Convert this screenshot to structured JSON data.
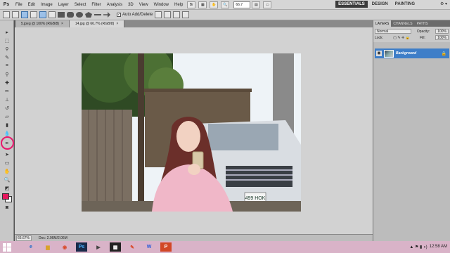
{
  "app": {
    "logo": "Ps"
  },
  "menu": [
    "File",
    "Edit",
    "Image",
    "Layer",
    "Select",
    "Filter",
    "Analysis",
    "3D",
    "View",
    "Window",
    "Help"
  ],
  "menubar": {
    "zoom": "66.7"
  },
  "workspaces": [
    "ESSENTIALS",
    "DESIGN",
    "PAINTING"
  ],
  "cs_live": "CS Live",
  "options": {
    "auto_add_delete": "Auto Add/Delete"
  },
  "tabs": [
    {
      "label": "5.jpeg @ 100% (RGB/8)",
      "close": "×"
    },
    {
      "label": "14.jpg @ 66.7% (RGB/8)",
      "close": "×"
    }
  ],
  "status": {
    "zoom": "66.67%",
    "doc": "Doc: 2.06M/2.06M"
  },
  "panels": {
    "tabs": [
      "LAYERS",
      "CHANNELS",
      "PATHS"
    ],
    "blend_mode": "Normal",
    "opacity_label": "Opacity:",
    "opacity_value": "100%",
    "lock_label": "Lock:",
    "fill_label": "Fill:",
    "fill_value": "100%",
    "layer_name": "Background"
  },
  "photo": {
    "plate": "499 HOK"
  },
  "taskbar": {
    "time": "12:58 AM"
  },
  "colors": {
    "foreground": "#e8175e",
    "background": "#ffffff",
    "highlight_ring": "#e8176b",
    "layer_selected": "#3e7ec8"
  }
}
